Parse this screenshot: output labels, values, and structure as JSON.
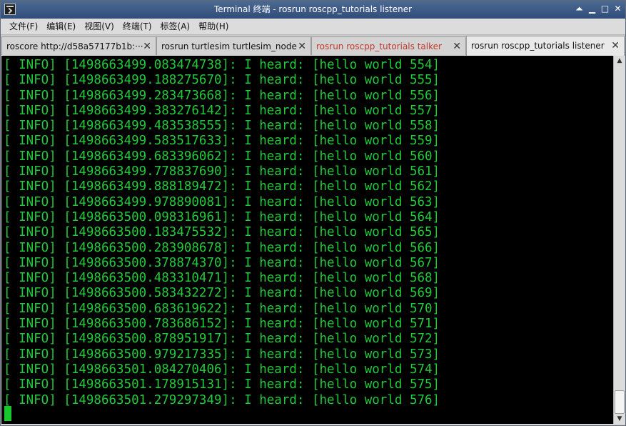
{
  "window": {
    "title": "Terminal 终端 - rosrun roscpp_tutorials listener",
    "icons": {
      "app": "terminal-icon",
      "shade": "shade-icon",
      "minimize": "minimize-icon",
      "maximize": "maximize-icon",
      "close": "close-icon"
    }
  },
  "menubar": {
    "items": [
      {
        "label": "文件(F)"
      },
      {
        "label": "编辑(E)"
      },
      {
        "label": "视图(V)"
      },
      {
        "label": "终端(T)"
      },
      {
        "label": "标签(A)"
      },
      {
        "label": "帮助(H)"
      }
    ]
  },
  "tabs": [
    {
      "label": "roscore http://d58a57177b1b:···",
      "color": "#111111",
      "active": false
    },
    {
      "label": "rosrun turtlesim turtlesim_node",
      "color": "#111111",
      "active": false
    },
    {
      "label": "rosrun roscpp_tutorials talker",
      "color": "#c0392b",
      "active": false
    },
    {
      "label": "rosrun roscpp_tutorials listener",
      "color": "#111111",
      "active": true
    }
  ],
  "terminal": {
    "text_color": "#22c93a",
    "background": "#000000",
    "lines": [
      "[ INFO] [1498663499.083474738]: I heard: [hello world 554]",
      "[ INFO] [1498663499.188275670]: I heard: [hello world 555]",
      "[ INFO] [1498663499.283473668]: I heard: [hello world 556]",
      "[ INFO] [1498663499.383276142]: I heard: [hello world 557]",
      "[ INFO] [1498663499.483538555]: I heard: [hello world 558]",
      "[ INFO] [1498663499.583517633]: I heard: [hello world 559]",
      "[ INFO] [1498663499.683396062]: I heard: [hello world 560]",
      "[ INFO] [1498663499.778837690]: I heard: [hello world 561]",
      "[ INFO] [1498663499.888189472]: I heard: [hello world 562]",
      "[ INFO] [1498663499.978890081]: I heard: [hello world 563]",
      "[ INFO] [1498663500.098316961]: I heard: [hello world 564]",
      "[ INFO] [1498663500.183475532]: I heard: [hello world 565]",
      "[ INFO] [1498663500.283908678]: I heard: [hello world 566]",
      "[ INFO] [1498663500.378874370]: I heard: [hello world 567]",
      "[ INFO] [1498663500.483310471]: I heard: [hello world 568]",
      "[ INFO] [1498663500.583432272]: I heard: [hello world 569]",
      "[ INFO] [1498663500.683619622]: I heard: [hello world 570]",
      "[ INFO] [1498663500.783686152]: I heard: [hello world 571]",
      "[ INFO] [1498663500.878951917]: I heard: [hello world 572]",
      "[ INFO] [1498663500.979217335]: I heard: [hello world 573]",
      "[ INFO] [1498663501.084270406]: I heard: [hello world 574]",
      "[ INFO] [1498663501.178915131]: I heard: [hello world 575]",
      "[ INFO] [1498663501.279297349]: I heard: [hello world 576]"
    ]
  },
  "scrollbar": {
    "position": 1.0
  }
}
